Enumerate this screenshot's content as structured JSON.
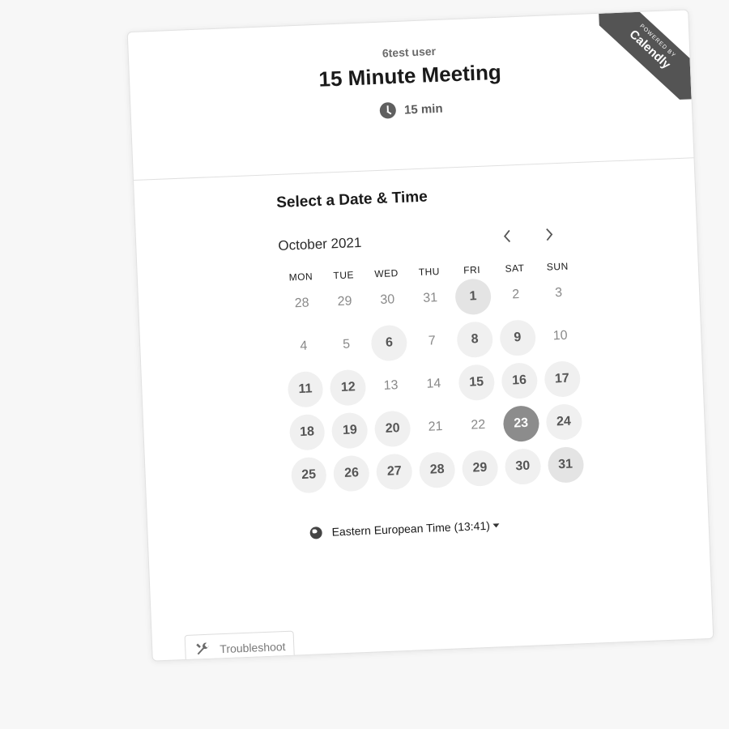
{
  "badge": {
    "small": "POWERED BY",
    "brand": "Calendly"
  },
  "header": {
    "owner": "6test user",
    "title": "15 Minute Meeting",
    "duration": "15 min",
    "duration_icon": "clock-icon"
  },
  "scheduler": {
    "title": "Select a Date & Time",
    "month": "October 2021",
    "prev_icon": "chevron-left-icon",
    "next_icon": "chevron-right-icon",
    "weekdays": [
      "MON",
      "TUE",
      "WED",
      "THU",
      "FRI",
      "SAT",
      "SUN"
    ],
    "weeks": [
      [
        "28",
        "29",
        "30",
        "31",
        "1",
        "2",
        "3"
      ],
      [
        "4",
        "5",
        "6",
        "7",
        "8",
        "9",
        "10"
      ],
      [
        "11",
        "12",
        "13",
        "14",
        "15",
        "16",
        "17"
      ],
      [
        "18",
        "19",
        "20",
        "21",
        "22",
        "23",
        "24"
      ],
      [
        "25",
        "26",
        "27",
        "28",
        "29",
        "30",
        "31"
      ]
    ],
    "selected_day": "23",
    "timezone": "Eastern European Time (13:41)",
    "timezone_icon": "globe-icon"
  },
  "footer": {
    "troubleshoot": "Troubleshoot",
    "troubleshoot_icon": "wrench-icon"
  }
}
